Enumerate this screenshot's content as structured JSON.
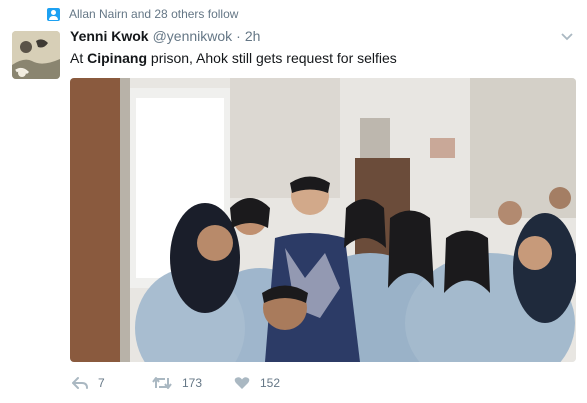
{
  "social_context": {
    "text": "Allan Nairn and 28 others follow",
    "icon": "follow-user-icon"
  },
  "tweet": {
    "author_name": "Yenni Kwok",
    "handle": "@yennikwok",
    "separator": "·",
    "time": "2h",
    "text_before": "At ",
    "text_bold": "Cipinang",
    "text_after": " prison, Ahok still gets request for selfies",
    "media_description_icon": "photo",
    "menu_icon": "chevron-down-icon"
  },
  "actions": {
    "reply_count": "7",
    "retweet_count": "173",
    "like_count": "152"
  },
  "colors": {
    "accent": "#1da1f2",
    "text": "#14171a",
    "muted": "#657786"
  }
}
